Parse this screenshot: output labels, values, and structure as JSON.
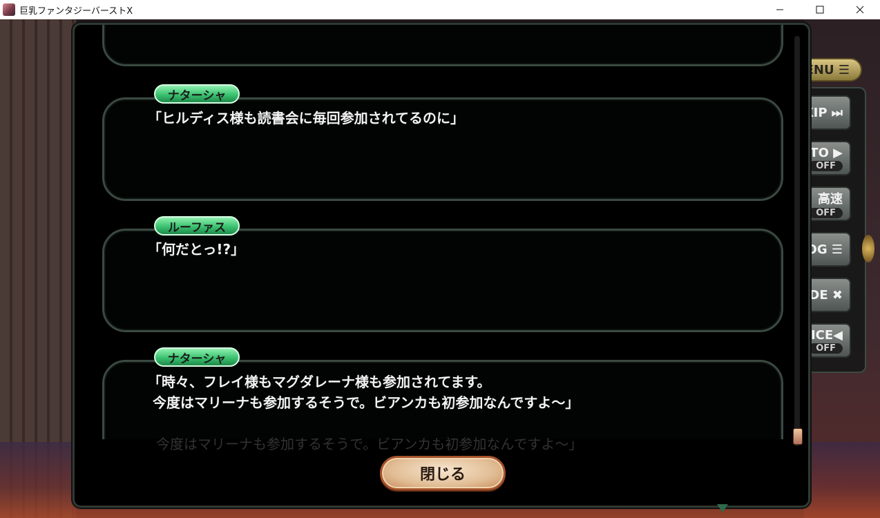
{
  "window": {
    "title": "巨乳ファンタジーバーストX"
  },
  "system_menu": {
    "menu_label": "ENU ☰",
    "buttons": [
      {
        "label": "KIP ⏭",
        "state": ""
      },
      {
        "label": "UTO ▶",
        "state": "OFF"
      },
      {
        "label": "高速",
        "state": "OFF"
      },
      {
        "label": "OG ☰",
        "state": ""
      },
      {
        "label": "DE ✖",
        "state": ""
      },
      {
        "label": "OICE◀",
        "state": "OFF"
      }
    ]
  },
  "backlog": {
    "entries": [
      {
        "speaker": "",
        "text": ""
      },
      {
        "speaker": "ナターシャ",
        "text": "「ヒルディス様も読書会に毎回参加されてるのに」"
      },
      {
        "speaker": "ルーファス",
        "text": "「何だとっ!?」"
      },
      {
        "speaker": "ナターシャ",
        "text": "「時々、フレイ様もマグダレーナ様も参加されてます。\n 今度はマリーナも参加するそうで。ビアンカも初参加なんですよ～」"
      }
    ],
    "ghost_text": "今度はマリーナも参加するそうで。ビアンカも初参加なんですよ～」",
    "close_label": "閉じる"
  }
}
